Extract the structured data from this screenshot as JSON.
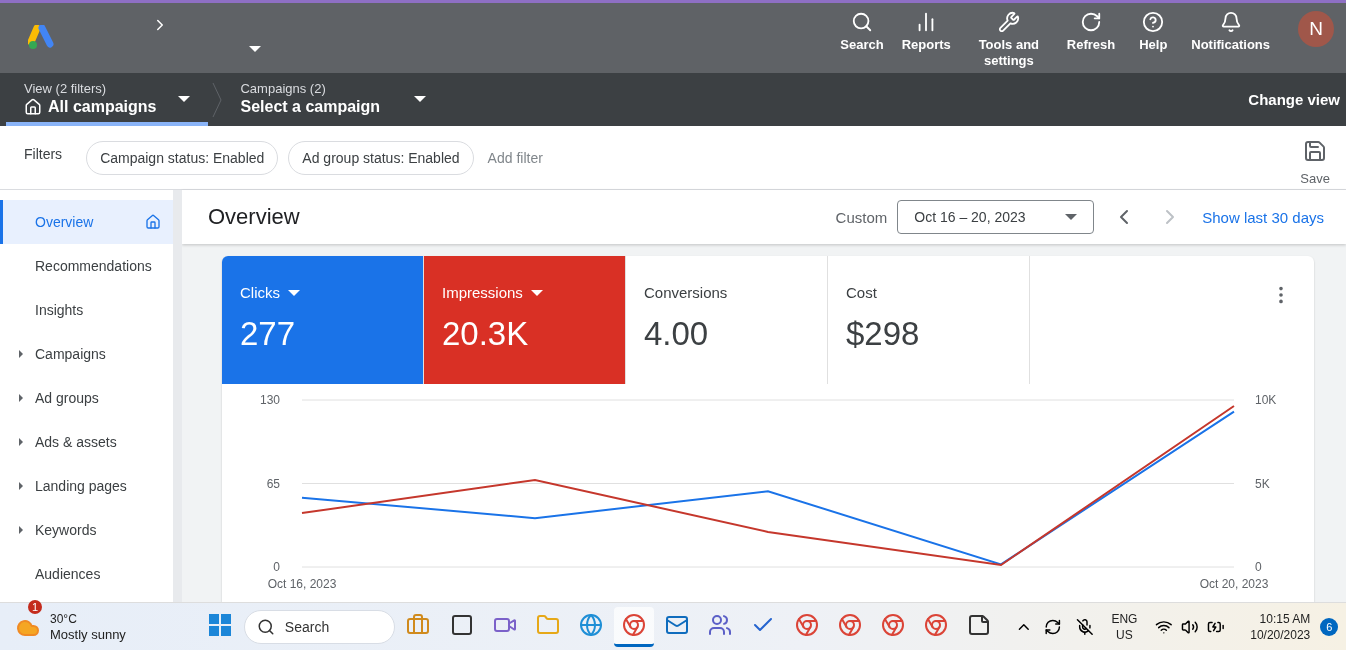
{
  "header": {
    "actions": [
      {
        "label": "Search"
      },
      {
        "label": "Reports"
      },
      {
        "label": "Tools and settings"
      },
      {
        "label": "Refresh"
      },
      {
        "label": "Help"
      },
      {
        "label": "Notifications"
      }
    ],
    "avatar": "N"
  },
  "scope_bar": {
    "pickers": [
      {
        "caption": "View (2 filters)",
        "value": "All campaigns",
        "home": true,
        "selected": true
      },
      {
        "caption": "Campaigns (2)",
        "value": "Select a campaign",
        "home": false,
        "selected": false
      }
    ],
    "change_view": "Change view"
  },
  "filters": {
    "label": "Filters",
    "chips": [
      "Campaign status: Enabled",
      "Ad group status: Enabled"
    ],
    "add": "Add filter",
    "save": "Save"
  },
  "sidebar": {
    "items": [
      {
        "label": "Overview",
        "selected": true,
        "expandable": false
      },
      {
        "label": "Recommendations",
        "selected": false,
        "expandable": false
      },
      {
        "label": "Insights",
        "selected": false,
        "expandable": false
      },
      {
        "label": "Campaigns",
        "selected": false,
        "expandable": true
      },
      {
        "label": "Ad groups",
        "selected": false,
        "expandable": true
      },
      {
        "label": "Ads & assets",
        "selected": false,
        "expandable": true
      },
      {
        "label": "Landing pages",
        "selected": false,
        "expandable": true
      },
      {
        "label": "Keywords",
        "selected": false,
        "expandable": true
      },
      {
        "label": "Audiences",
        "selected": false,
        "expandable": false
      }
    ]
  },
  "page": {
    "title": "Overview",
    "range_label": "Custom",
    "range": "Oct 16 – 20, 2023",
    "show_last": "Show last 30 days"
  },
  "metrics": [
    {
      "label": "Clicks",
      "value": "277",
      "color": "#1a73e8",
      "dropdown": true
    },
    {
      "label": "Impressions",
      "value": "20.3K",
      "color": "#d93025",
      "dropdown": true
    },
    {
      "label": "Conversions",
      "value": "4.00",
      "dropdown": false
    },
    {
      "label": "Cost",
      "value": "$298",
      "dropdown": false
    }
  ],
  "chart_data": {
    "type": "line",
    "categories": [
      "Oct 16, 2023",
      null,
      null,
      null,
      "Oct 20, 2023"
    ],
    "ylim": [
      0,
      130
    ],
    "yticks": [
      0,
      65,
      130
    ],
    "y2lim": [
      0,
      10000
    ],
    "y2ticks": [
      {
        "value": 0,
        "label": "0"
      },
      {
        "value": 5000,
        "label": "5K"
      },
      {
        "value": 10000,
        "label": "10K"
      }
    ],
    "series": [
      {
        "color": "#1a73e8",
        "values": [
          54,
          38,
          59,
          2,
          121
        ]
      },
      {
        "color": "#c5372c",
        "axis": "y2",
        "values": [
          3230,
          5210,
          2100,
          120,
          9640
        ]
      }
    ]
  },
  "taskbar": {
    "weather": {
      "badge": "1",
      "temp": "30°C",
      "desc": "Mostly sunny"
    },
    "search": "Search",
    "apps": [
      {
        "active": false
      },
      {
        "active": false
      },
      {
        "active": false
      },
      {
        "active": false
      },
      {
        "active": false
      },
      {
        "active": true
      },
      {
        "active": false
      },
      {
        "active": false
      },
      {
        "active": false
      },
      {
        "active": false
      },
      {
        "active": false
      },
      {
        "active": false
      },
      {
        "active": false
      },
      {
        "active": false
      }
    ],
    "lang": "ENG",
    "region": "US",
    "time": "10:15 AM",
    "date": "10/20/2023",
    "notif": "6"
  }
}
